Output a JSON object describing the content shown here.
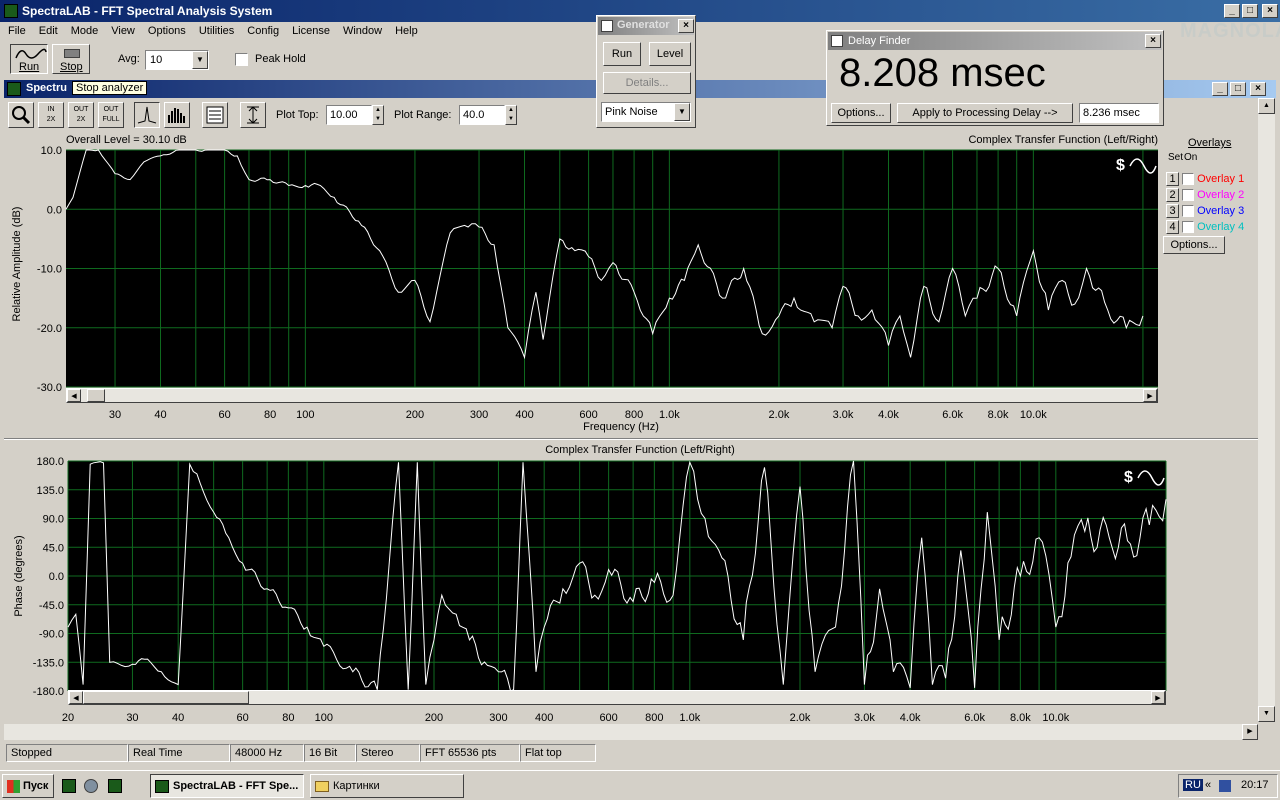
{
  "app": {
    "title": "SpectraLAB - FFT Spectral Analysis System"
  },
  "menu": [
    "File",
    "Edit",
    "Mode",
    "View",
    "Options",
    "Utilities",
    "Config",
    "License",
    "Window",
    "Help"
  ],
  "toolbar": {
    "run_label": "Run",
    "stop_label": "Stop",
    "avg_label": "Avg:",
    "avg_value": "10",
    "peak_hold_label": "Peak Hold",
    "tooltip": "Stop analyzer"
  },
  "spectrum_window": {
    "title": "Spectru",
    "plot_top_label": "Plot Top:",
    "plot_top_value": "10.00",
    "plot_range_label": "Plot Range:",
    "plot_range_value": "40.0"
  },
  "top_chart": {
    "title": "Complex Transfer Function (Left/Right)",
    "overall_level": "Overall Level = 30.10 dB",
    "xlabel": "Frequency (Hz)",
    "ylabel": "Relative Amplitude (dB)",
    "yticks": [
      "10.0",
      "0.0",
      "-10.0",
      "-20.0",
      "-30.0"
    ],
    "xticks": [
      "30",
      "40",
      "60",
      "80",
      "100",
      "200",
      "300",
      "400",
      "600",
      "800",
      "1.0k",
      "2.0k",
      "3.0k",
      "4.0k",
      "6.0k",
      "8.0k",
      "10.0k"
    ]
  },
  "bottom_chart": {
    "title": "Complex Transfer Function (Left/Right)",
    "ylabel": "Phase (degrees)",
    "yticks": [
      "180.0",
      "135.0",
      "90.0",
      "45.0",
      "0.0",
      "-45.0",
      "-90.0",
      "-135.0",
      "-180.0"
    ],
    "xticks": [
      "20",
      "30",
      "40",
      "60",
      "80",
      "100",
      "200",
      "300",
      "400",
      "600",
      "800",
      "1.0k",
      "2.0k",
      "3.0k",
      "4.0k",
      "6.0k",
      "8.0k",
      "10.0k"
    ]
  },
  "overlays": {
    "header": "Overlays",
    "set_label": "Set",
    "on_label": "On",
    "items": [
      {
        "num": "1",
        "label": "Overlay 1",
        "color": "#ff0000"
      },
      {
        "num": "2",
        "label": "Overlay 2",
        "color": "#ff00ff"
      },
      {
        "num": "3",
        "label": "Overlay 3",
        "color": "#0000ff"
      },
      {
        "num": "4",
        "label": "Overlay 4",
        "color": "#00c0c0"
      }
    ],
    "options_label": "Options..."
  },
  "generator": {
    "title": "Generator",
    "run_label": "Run",
    "level_label": "Level",
    "details_label": "Details...",
    "signal": "Pink Noise"
  },
  "delay_finder": {
    "title": "Delay Finder",
    "value": "8.208 msec",
    "options_label": "Options...",
    "apply_label": "Apply to Processing Delay -->",
    "applied_value": "8.236 msec"
  },
  "watermark": "MAGNOLA",
  "status": [
    "Stopped",
    "Real Time",
    "48000 Hz",
    "16 Bit",
    "Stereo",
    "FFT 65536 pts",
    "Flat top"
  ],
  "taskbar": {
    "start_label": "Пуск",
    "task1": "SpectraLAB - FFT Spe...",
    "task2": "Картинки",
    "lang": "RU",
    "clock": "20:17"
  },
  "chart_data": [
    {
      "type": "line",
      "title": "Complex Transfer Function (Left/Right)",
      "xlabel": "Frequency (Hz)",
      "ylabel": "Relative Amplitude (dB)",
      "xscale": "log",
      "xlim": [
        22,
        22000
      ],
      "ylim": [
        -30,
        10
      ],
      "grid": true,
      "x": [
        22,
        23,
        25,
        27,
        30,
        33,
        36,
        40,
        45,
        50,
        55,
        60,
        65,
        70,
        80,
        90,
        100,
        110,
        120,
        140,
        160,
        180,
        200,
        220,
        250,
        280,
        300,
        330,
        360,
        400,
        430,
        450,
        500,
        550,
        600,
        650,
        700,
        800,
        900,
        1000,
        1100,
        1200,
        1400,
        1600,
        1800,
        2000,
        2200,
        2500,
        2800,
        3000,
        3300,
        3600,
        4000,
        4300,
        4600,
        5000,
        5500,
        6000,
        6500,
        7000,
        8000,
        9000,
        10000,
        11000,
        12000,
        13000,
        14000,
        16000,
        18000,
        20000
      ],
      "y": [
        0,
        2,
        10,
        10,
        6,
        5,
        8,
        9,
        10,
        10,
        10,
        10,
        9,
        5,
        5,
        4,
        4,
        4,
        2,
        -2,
        -7,
        -14,
        -12,
        -19,
        -4,
        -3,
        -3,
        -6,
        -20,
        -25,
        -14,
        -22,
        -5,
        -7,
        -8,
        -12,
        -9,
        -14,
        -21,
        -15,
        -12,
        -6,
        -15,
        -10,
        -21,
        -18,
        -15,
        -19,
        -20,
        -13,
        -18,
        -17,
        -23,
        -18,
        -25,
        -13,
        -19,
        -10,
        -18,
        -15,
        -10,
        -18,
        -7,
        -17,
        -12,
        -16,
        -10,
        -17,
        -20,
        -18
      ]
    },
    {
      "type": "line",
      "title": "Complex Transfer Function (Left/Right)",
      "ylabel": "Phase (degrees)",
      "xscale": "log",
      "xlim": [
        20,
        20000
      ],
      "ylim": [
        -180,
        180
      ],
      "grid": true,
      "x": [
        20,
        21,
        22,
        23,
        24,
        25,
        26,
        28,
        30,
        33,
        36,
        40,
        43,
        45,
        50,
        55,
        60,
        70,
        80,
        90,
        100,
        120,
        140,
        160,
        170,
        180,
        190,
        200,
        210,
        230,
        250,
        280,
        300,
        330,
        350,
        380,
        400,
        450,
        500,
        550,
        600,
        700,
        800,
        900,
        1000,
        1050,
        1100,
        1200,
        1400,
        1600,
        1800,
        2000,
        2200,
        2500,
        2800,
        3000,
        3300,
        3600,
        4000,
        4300,
        4600,
        5000,
        5500,
        6000,
        6500,
        7000,
        8000,
        9000,
        10000,
        11000,
        12000,
        14000,
        16000,
        18000,
        20000
      ],
      "y": [
        -80,
        -60,
        -170,
        175,
        178,
        177,
        -135,
        -140,
        -138,
        -130,
        -150,
        -170,
        175,
        160,
        100,
        60,
        20,
        -20,
        -50,
        -80,
        -110,
        -150,
        -178,
        178,
        -178,
        178,
        -170,
        -100,
        -30,
        -60,
        -100,
        -140,
        -150,
        -178,
        178,
        -150,
        -80,
        -20,
        20,
        -30,
        10,
        -40,
        -10,
        -30,
        178,
        120,
        90,
        40,
        -100,
        170,
        -170,
        140,
        -150,
        -80,
        180,
        -170,
        -20,
        -150,
        -175,
        60,
        -170,
        -160,
        40,
        -175,
        100,
        -100,
        0,
        60,
        -80,
        30,
        70,
        60,
        50,
        80,
        120
      ]
    }
  ]
}
